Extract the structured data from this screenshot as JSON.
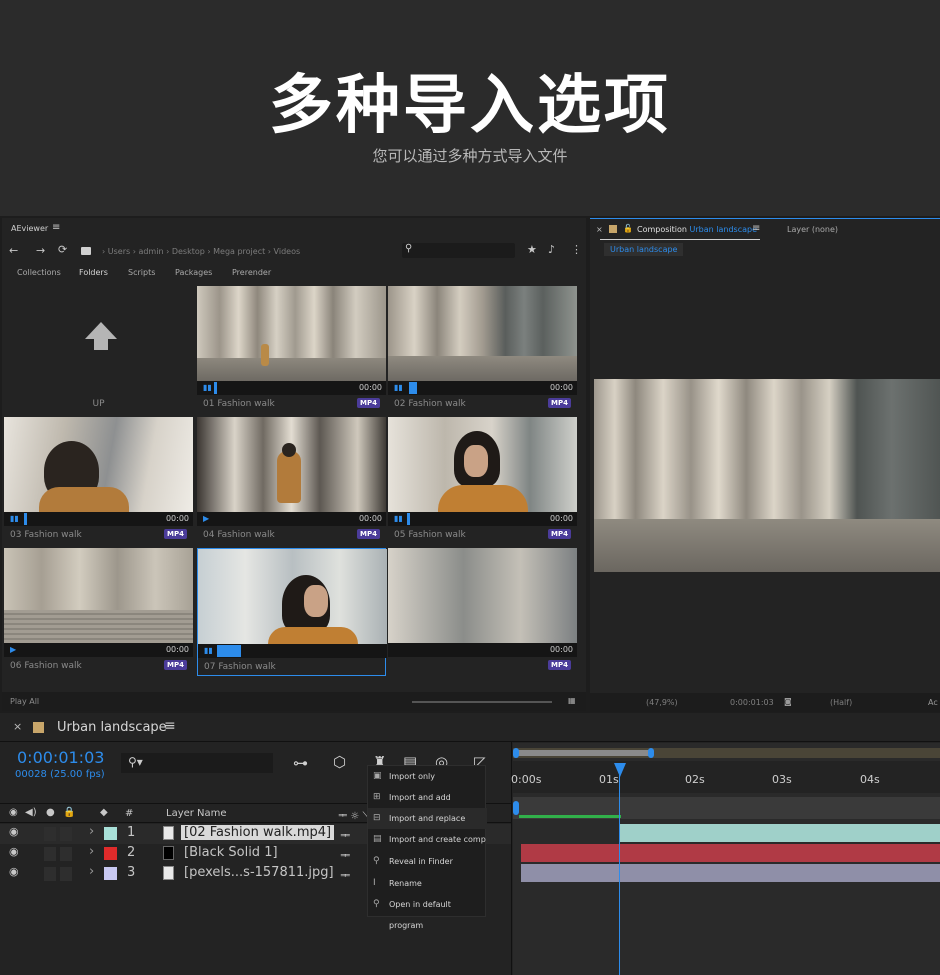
{
  "hero": {
    "title": "多种导入选项",
    "subtitle": "您可以通过多种方式导入文件"
  },
  "aeviewer": {
    "title": "AEviewer",
    "breadcrumb": [
      "Users",
      "admin",
      "Desktop",
      "Mega project",
      "Videos"
    ],
    "tabs": [
      "Collections",
      "Folders",
      "Scripts",
      "Packages",
      "Prerender"
    ],
    "up_label": "UP",
    "footer_label": "Play All",
    "tiles": [
      {
        "name": "01 Fashion walk",
        "time": "00:00",
        "badge": "MP4"
      },
      {
        "name": "02 Fashion walk",
        "time": "00:00",
        "badge": "MP4"
      },
      {
        "name": "03 Fashion walk",
        "time": "00:00",
        "badge": "MP4"
      },
      {
        "name": "04 Fashion walk",
        "time": "00:00",
        "badge": "MP4"
      },
      {
        "name": "05 Fashion walk",
        "time": "00:00",
        "badge": "MP4"
      },
      {
        "name": "06 Fashion walk",
        "time": "00:00",
        "badge": "MP4"
      },
      {
        "name": "07 Fashion walk",
        "time": "",
        "badge": ""
      },
      {
        "name": "",
        "time": "00:00",
        "badge": "MP4"
      }
    ],
    "context_menu": [
      "Import only",
      "Import and add",
      "Import and replace",
      "Import and create comp",
      "Reveal in Finder",
      "Rename",
      "Open in default program"
    ]
  },
  "composition": {
    "tab_prefix": "Composition",
    "tab_name": "Urban landscape",
    "layer_tab": "Layer (none)",
    "sub_tab": "Urban landscape",
    "zoom": "(47,9%)",
    "time": "0:00:01:03",
    "resolution": "(Half)",
    "more": "Ac"
  },
  "timeline": {
    "comp_name": "Urban landscape",
    "timecode": "0:00:01:03",
    "frames": "00028 (25.00 fps)",
    "ruler": [
      "0:00s",
      "01s",
      "02s",
      "03s",
      "04s"
    ],
    "col_hash": "#",
    "col_layer_name": "Layer Name",
    "layers": [
      {
        "num": "1",
        "name": "[02 Fashion walk.mp4]",
        "label_color": "#a8e0d8",
        "bar_color": "#9fd0c9"
      },
      {
        "num": "2",
        "name": "[Black Solid 1]",
        "label_color": "#e02b2b",
        "bar_color": "#b03a45"
      },
      {
        "num": "3",
        "name": "[pexels...s-157811.jpg]",
        "label_color": "#c9c9f2",
        "bar_color": "#8f8fa8"
      }
    ]
  },
  "colors": {
    "accent": "#2d8ceb",
    "badge": "#4b3c9a"
  },
  "icons": [
    "back-icon",
    "forward-icon",
    "refresh-icon",
    "folder-icon",
    "search-icon",
    "star-icon",
    "bell-icon",
    "more-icon",
    "menu-icon",
    "close-icon",
    "eye-icon",
    "lock-icon"
  ]
}
